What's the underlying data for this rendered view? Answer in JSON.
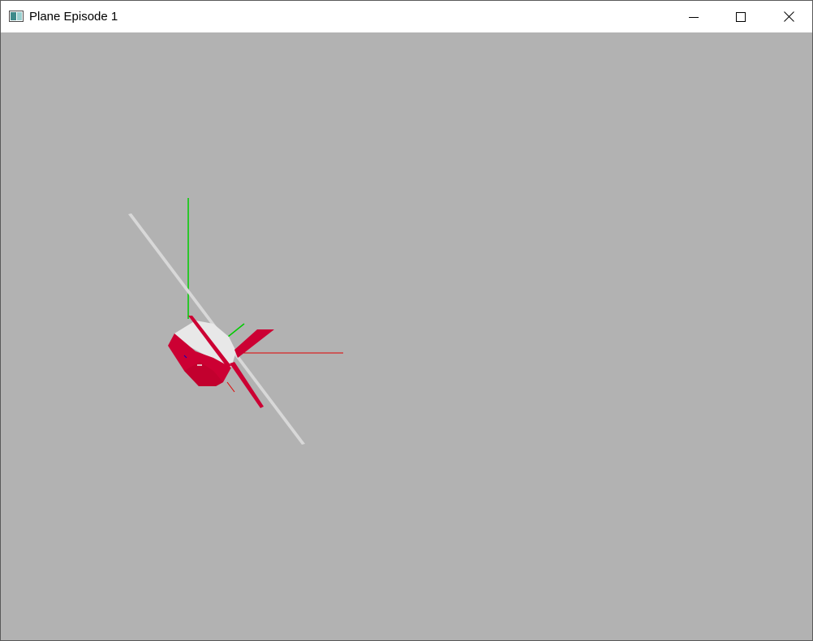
{
  "window": {
    "title": "Plane Episode 1"
  },
  "controls": {
    "minimize_icon": "minimize-icon",
    "maximize_icon": "maximize-icon",
    "close_icon": "close-icon"
  },
  "scene": {
    "background_color": "#b2b2b2",
    "plane_color": "#cc0033",
    "plane_light_color": "#e8e8e8",
    "axis_x_color": "#e00000",
    "axis_y_color": "#00cc00",
    "axis_z_color": "#0000cc"
  }
}
